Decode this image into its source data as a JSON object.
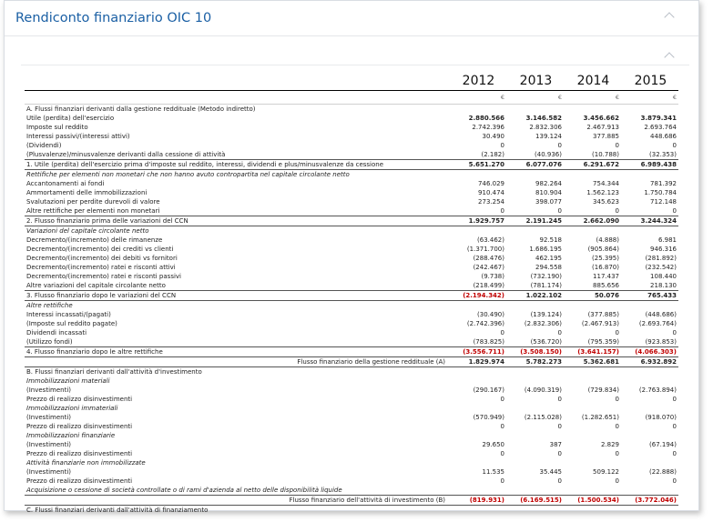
{
  "panel": {
    "title": "Rendiconto finanziario OIC 10"
  },
  "header": {
    "years": [
      "2012",
      "2013",
      "2014",
      "2015"
    ],
    "currency": "€"
  },
  "rows": [
    {
      "label": "A. Flussi finanziari derivanti dalla gestione reddituale (Metodo indiretto)",
      "values": [
        "",
        "",
        "",
        ""
      ],
      "style": "section"
    },
    {
      "label": "Utile (perdita) dell'esercizio",
      "values": [
        "2.880.566",
        "3.146.582",
        "3.456.662",
        "3.879.341"
      ],
      "style": "boldvals"
    },
    {
      "label": "Imposte sul reddito",
      "values": [
        "2.742.396",
        "2.832.306",
        "2.467.913",
        "2.693.764"
      ],
      "style": ""
    },
    {
      "label": "Interessi passivi/(interessi attivi)",
      "values": [
        "30.490",
        "139.124",
        "377.885",
        "448.686"
      ],
      "style": ""
    },
    {
      "label": "(Dividendi)",
      "values": [
        "0",
        "0",
        "0",
        "0"
      ],
      "style": ""
    },
    {
      "label": "(Plusvalenze)/minusvalenze derivanti dalla cessione di attività",
      "values": [
        "(2.182)",
        "(40.936)",
        "(10.788)",
        "(32.353)"
      ],
      "style": ""
    },
    {
      "label": "1. Utile (perdita) dell'esercizio prima d'imposte sul reddito, interessi, dividendi e plus/minusvalenze da cessione",
      "values": [
        "5.651.270",
        "6.077.076",
        "6.291.672",
        "6.989.438"
      ],
      "style": "total"
    },
    {
      "label": "Rettifiche per elementi non monetari che non hanno avuto contropartita nel capitale circolante netto",
      "values": [
        "",
        "",
        "",
        ""
      ],
      "style": "italic"
    },
    {
      "label": "Accantonamenti ai fondi",
      "values": [
        "746.029",
        "982.264",
        "754.344",
        "781.392"
      ],
      "style": ""
    },
    {
      "label": "Ammortamenti delle immobilizzazioni",
      "values": [
        "910.474",
        "810.904",
        "1.562.123",
        "1.750.784"
      ],
      "style": ""
    },
    {
      "label": "Svalutazioni per perdite durevoli di valore",
      "values": [
        "273.254",
        "398.077",
        "345.623",
        "712.148"
      ],
      "style": ""
    },
    {
      "label": "Altre rettifiche per elementi non monetari",
      "values": [
        "0",
        "0",
        "0",
        "0"
      ],
      "style": ""
    },
    {
      "label": "2. Flusso finanziario prima delle variazioni del CCN",
      "values": [
        "1.929.757",
        "2.191.245",
        "2.662.090",
        "3.244.324"
      ],
      "style": "total"
    },
    {
      "label": "Variazioni del capitale circolante netto",
      "values": [
        "",
        "",
        "",
        ""
      ],
      "style": "italic"
    },
    {
      "label": "Decremento/(incremento) delle rimanenze",
      "values": [
        "(63.462)",
        "92.518",
        "(4.888)",
        "6.981"
      ],
      "style": ""
    },
    {
      "label": "Decremento/(incremento) dei crediti vs clienti",
      "values": [
        "(1.371.700)",
        "1.686.195",
        "(905.864)",
        "946.316"
      ],
      "style": ""
    },
    {
      "label": "Decremento/(incremento) dei debiti vs fornitori",
      "values": [
        "(288.476)",
        "462.195",
        "(25.395)",
        "(281.892)"
      ],
      "style": ""
    },
    {
      "label": "Decremento/(incremento) ratei e risconti attivi",
      "values": [
        "(242.467)",
        "294.558",
        "(16.870)",
        "(232.542)"
      ],
      "style": ""
    },
    {
      "label": "Decremento/(incremento) ratei e risconti passivi",
      "values": [
        "(9.738)",
        "(732.190)",
        "117.437",
        "108.440"
      ],
      "style": ""
    },
    {
      "label": "Altre variazioni del capitale circolante netto",
      "values": [
        "(218.499)",
        "(781.174)",
        "885.656",
        "218.130"
      ],
      "style": ""
    },
    {
      "label": "3. Flusso finanziario dopo le variazioni del CCN",
      "values": [
        "(2.194.342)",
        "1.022.102",
        "50.076",
        "765.433"
      ],
      "style": "total",
      "red": [
        true,
        false,
        false,
        false
      ]
    },
    {
      "label": "Altre rettifiche",
      "values": [
        "",
        "",
        "",
        ""
      ],
      "style": "italic"
    },
    {
      "label": "Interessi incassati/(pagati)",
      "values": [
        "(30.490)",
        "(139.124)",
        "(377.885)",
        "(448.686)"
      ],
      "style": ""
    },
    {
      "label": "(Imposte sul reddito pagate)",
      "values": [
        "(2.742.396)",
        "(2.832.306)",
        "(2.467.913)",
        "(2.693.764)"
      ],
      "style": ""
    },
    {
      "label": "Dividendi incassati",
      "values": [
        "0",
        "0",
        "0",
        "0"
      ],
      "style": ""
    },
    {
      "label": "(Utilizzo fondi)",
      "values": [
        "(783.825)",
        "(536.720)",
        "(795.359)",
        "(923.853)"
      ],
      "style": ""
    },
    {
      "label": "4. Flusso finanziario dopo le altre rettifiche",
      "values": [
        "(3.556.711)",
        "(3.508.150)",
        "(3.641.157)",
        "(4.066.303)"
      ],
      "style": "total",
      "red": [
        true,
        true,
        true,
        true
      ]
    },
    {
      "label": "Flusso finanziario della gestione reddituale (A)",
      "values": [
        "1.829.974",
        "5.782.273",
        "5.362.681",
        "6.932.892"
      ],
      "style": "grand"
    },
    {
      "label": "B. Flussi finanziari derivanti dall'attività d'investimento",
      "values": [
        "",
        "",
        "",
        ""
      ],
      "style": "section"
    },
    {
      "label": "Immobilizzazioni materiali",
      "values": [
        "",
        "",
        "",
        ""
      ],
      "style": "italic"
    },
    {
      "label": "(Investimenti)",
      "values": [
        "(290.167)",
        "(4.090.319)",
        "(729.834)",
        "(2.763.894)"
      ],
      "style": ""
    },
    {
      "label": "Prezzo di realizzo disinvestimenti",
      "values": [
        "0",
        "0",
        "0",
        "0"
      ],
      "style": ""
    },
    {
      "label": "Immobilizzazioni immateriali",
      "values": [
        "",
        "",
        "",
        ""
      ],
      "style": "italic"
    },
    {
      "label": "(Investimenti)",
      "values": [
        "(570.949)",
        "(2.115.028)",
        "(1.282.651)",
        "(918.070)"
      ],
      "style": ""
    },
    {
      "label": "Prezzo di realizzo disinvestimenti",
      "values": [
        "0",
        "0",
        "0",
        "0"
      ],
      "style": ""
    },
    {
      "label": "Immobilizzazioni finanziarie",
      "values": [
        "",
        "",
        "",
        ""
      ],
      "style": "italic"
    },
    {
      "label": "(Investimenti)",
      "values": [
        "29.650",
        "387",
        "2.829",
        "(67.194)"
      ],
      "style": ""
    },
    {
      "label": "Prezzo di realizzo disinvestimenti",
      "values": [
        "0",
        "0",
        "0",
        "0"
      ],
      "style": ""
    },
    {
      "label": "Attività finanziarie non immobilizzate",
      "values": [
        "",
        "",
        "",
        ""
      ],
      "style": "italic"
    },
    {
      "label": "(Investimenti)",
      "values": [
        "11.535",
        "35.445",
        "509.122",
        "(22.888)"
      ],
      "style": ""
    },
    {
      "label": "Prezzo di realizzo disinvestimenti",
      "values": [
        "0",
        "0",
        "0",
        "0"
      ],
      "style": ""
    },
    {
      "label": "Acquisizione o cessione di società controllate o di rami d'azienda al netto delle disponibilità liquide",
      "values": [
        "",
        "",
        "",
        ""
      ],
      "style": "italic"
    },
    {
      "label": "Flusso finanziario dell'attività di investimento (B)",
      "values": [
        "(819.931)",
        "(6.169.515)",
        "(1.500.534)",
        "(3.772.046)"
      ],
      "style": "grand",
      "red": [
        true,
        true,
        true,
        true
      ]
    },
    {
      "label": "C. Flussi finanziari derivanti dall'attività di finanziamento",
      "values": [
        "",
        "",
        "",
        ""
      ],
      "style": "section"
    }
  ]
}
